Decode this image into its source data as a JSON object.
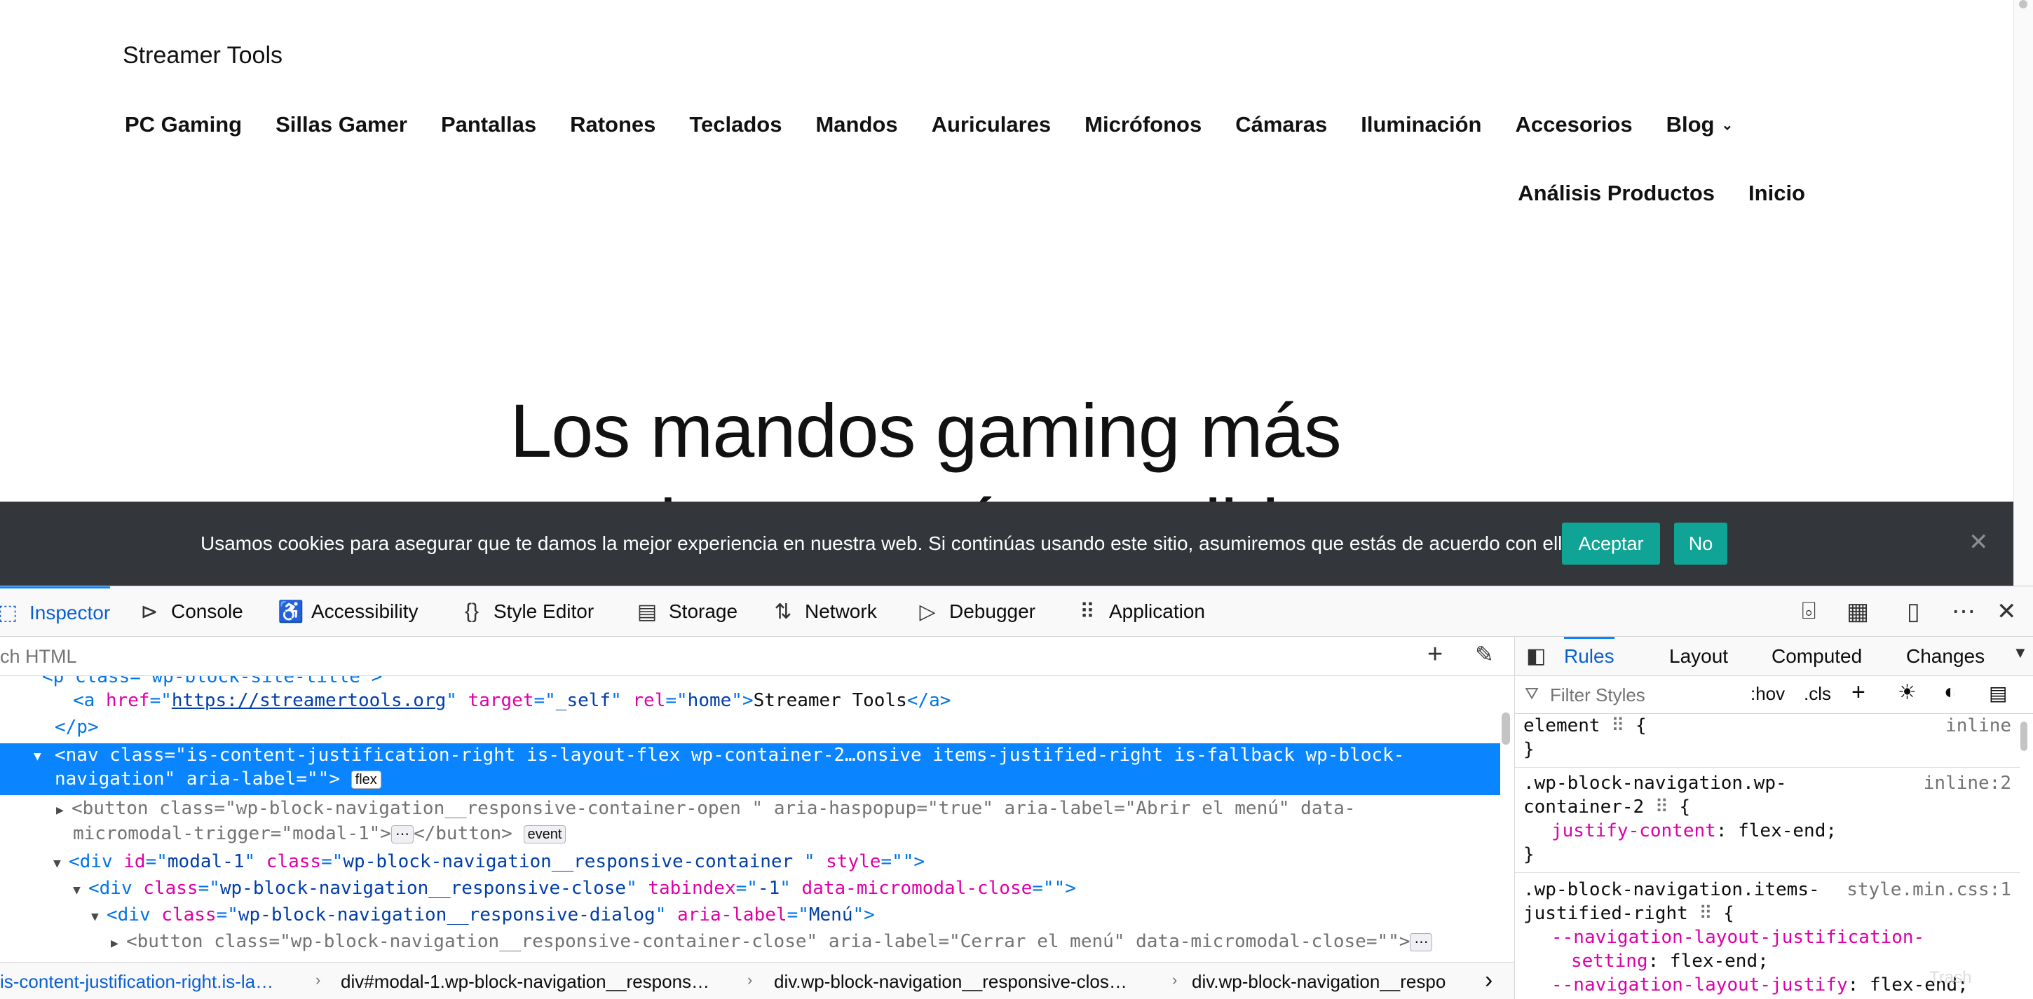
{
  "site": {
    "title": "Streamer Tools",
    "nav_row1": [
      "PC Gaming",
      "Sillas Gamer",
      "Pantallas",
      "Ratones",
      "Teclados",
      "Mandos",
      "Auriculares",
      "Micrófonos",
      "Cámaras",
      "Iluminación",
      "Accesorios"
    ],
    "nav_blog": "Blog",
    "nav_row2": [
      "Análisis Productos",
      "Inicio"
    ],
    "hero_line1": "Los mandos gaming más",
    "hero_line2": "populares y más vendidos"
  },
  "cookie": {
    "text": "Usamos cookies para asegurar que te damos la mejor experiencia en nuestra web. Si continúas usando este sitio, asumiremos que estás de acuerdo con ello.",
    "accept": "Aceptar",
    "no": "No",
    "close": "✕",
    "accent": "#0fa495"
  },
  "devtools": {
    "tabs": [
      "Inspector",
      "Console",
      "Accessibility",
      "Style Editor",
      "Storage",
      "Network",
      "Debugger",
      "Application"
    ],
    "search_placeholder": "ch HTML",
    "markup": {
      "l0": "<p class=\"wp-block-site-title\">",
      "l1_tag_open": "<a ",
      "l1_href_attr": "href",
      "l1_href": "https://streamertools.org",
      "l1_target_attr": "target",
      "l1_target": "_self",
      "l1_rel_attr": "rel",
      "l1_rel": "home",
      "l1_text": "Streamer Tools",
      "l1_close": "</a>",
      "l2": "</p>",
      "l3a": "<nav class=\"is-content-justification-right is-layout-flex wp-container-2…onsive items-justified-right is-fallback wp-block-",
      "l3b": "navigation\" aria-label=\"\">",
      "flex_badge": "flex",
      "l4a_tag": "<button ",
      "l4a_attrs": "class=\"wp-block-navigation__responsive-container-open \" aria-haspopup=\"true\" aria-label=\"Abrir el menú\" data-",
      "l4b_attrs": "micromodal-trigger=\"modal-1\">",
      "l4b_close": "</button>",
      "ellipsis_badge": "⋯",
      "event_badge": "event",
      "l5_tag": "<div ",
      "l5_id_attr": "id",
      "l5_id": "modal-1",
      "l5_class_attr": "class",
      "l5_class": "wp-block-navigation__responsive-container ",
      "l5_style_attr": "style",
      "l5_style": "",
      "l6_class": "wp-block-navigation__responsive-close",
      "l6_tabindex_attr": "tabindex",
      "l6_tabindex": "-1",
      "l6_data_attr": "data-micromodal-close",
      "l7_class": "wp-block-navigation__responsive-dialog",
      "l7_aria_attr": "aria-label",
      "l7_aria": "Menú",
      "l8": "<button class=\"wp-block-navigation__responsive-container-close\" aria-label=\"Cerrar el menú\" data-micromodal-close=\"\">"
    },
    "breadcrumbs": [
      "is-content-justification-right.is-la…",
      "div#modal-1.wp-block-navigation__respons…",
      "div.wp-block-navigation__responsive-clos…",
      "div.wp-block-navigation__respo"
    ],
    "side_tabs": [
      "Rules",
      "Layout",
      "Computed",
      "Changes"
    ],
    "filter_placeholder": "Filter Styles",
    "hov": ":hov",
    "cls": ".cls",
    "rules": {
      "r1_selector": "element",
      "r1_source": "inline",
      "r2_selector_a": ".wp-block-navigation.wp-",
      "r2_selector_b": "container-2",
      "r2_source": "inline:2",
      "r2_prop": "justify-content",
      "r2_val": "flex-end;",
      "r3_selector_a": ".wp-block-navigation.items-",
      "r3_selector_b": "justified-right",
      "r3_source": "style.min.css:1",
      "r3_prop1a": "--navigation-layout-justification-",
      "r3_prop1b": "setting",
      "r3_val1": "flex-end;",
      "r3_prop2": "--navigation-layout-justify",
      "r3_val2": "flex-end;",
      "open_brace": "{",
      "close_brace": "}",
      "ghost": "Trash"
    }
  }
}
